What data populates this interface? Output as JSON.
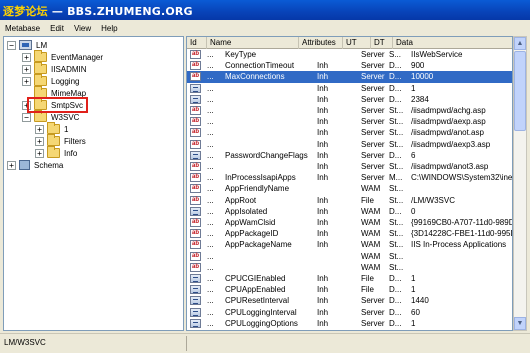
{
  "watermark": {
    "cjk": "逐梦论坛",
    "url": "BBS.ZHUMENG.ORG"
  },
  "menu": {
    "metabase": "Metabase",
    "edit": "Edit",
    "view": "View",
    "help": "Help"
  },
  "tree": {
    "root": {
      "label": "LM",
      "expander": "−"
    },
    "children": [
      {
        "label": "EventManager",
        "expander": "+"
      },
      {
        "label": "IISADMIN",
        "expander": "+"
      },
      {
        "label": "Logging",
        "expander": "+"
      },
      {
        "label": "MimeMap",
        "expander": ""
      },
      {
        "label": "SmtpSvc",
        "expander": "+"
      },
      {
        "label": "W3SVC",
        "expander": "−"
      }
    ],
    "w3svc_children": [
      {
        "label": "1",
        "expander": "+"
      },
      {
        "label": "Filters",
        "expander": "+"
      },
      {
        "label": "Info",
        "expander": "+"
      }
    ],
    "schema": {
      "label": "Schema",
      "expander": "+"
    }
  },
  "columns": [
    "Id",
    "Name",
    "Attributes",
    "UT",
    "DT",
    "Data"
  ],
  "rows": [
    {
      "icon": "ab",
      "id": "...",
      "name": "KeyType",
      "attributes": "",
      "ut": "Server",
      "dt": "S...",
      "data": "IIsWebService"
    },
    {
      "icon": "ab",
      "id": "...",
      "name": "ConnectionTimeout",
      "attributes": "Inh",
      "ut": "Server",
      "dt": "D...",
      "data": "900"
    },
    {
      "icon": "ab",
      "id": "...",
      "name": "MaxConnections",
      "attributes": "Inh",
      "ut": "Server",
      "dt": "D...",
      "data": "10000",
      "selected": true
    },
    {
      "icon": "bin",
      "id": "...",
      "name": "",
      "attributes": "Inh",
      "ut": "Server",
      "dt": "D...",
      "data": "1"
    },
    {
      "icon": "bin",
      "id": "...",
      "name": "",
      "attributes": "Inh",
      "ut": "Server",
      "dt": "D...",
      "data": "2384"
    },
    {
      "icon": "ab",
      "id": "...",
      "name": "",
      "attributes": "Inh",
      "ut": "Server",
      "dt": "St...",
      "data": "/iisadmpwd/achg.asp"
    },
    {
      "icon": "ab",
      "id": "...",
      "name": "",
      "attributes": "Inh",
      "ut": "Server",
      "dt": "St...",
      "data": "/iisadmpwd/aexp.asp"
    },
    {
      "icon": "ab",
      "id": "...",
      "name": "",
      "attributes": "Inh",
      "ut": "Server",
      "dt": "St...",
      "data": "/iisadmpwd/anot.asp"
    },
    {
      "icon": "ab",
      "id": "...",
      "name": "",
      "attributes": "Inh",
      "ut": "Server",
      "dt": "St...",
      "data": "/iisadmpwd/aexp3.asp"
    },
    {
      "icon": "bin",
      "id": "...",
      "name": "PasswordChangeFlags",
      "attributes": "Inh",
      "ut": "Server",
      "dt": "D...",
      "data": "6"
    },
    {
      "icon": "ab",
      "id": "...",
      "name": "",
      "attributes": "Inh",
      "ut": "Server",
      "dt": "St...",
      "data": "/iisadmpwd/anot3.asp"
    },
    {
      "icon": "ab",
      "id": "...",
      "name": "InProcessIsapiApps",
      "attributes": "Inh",
      "ut": "Server",
      "dt": "M...",
      "data": "C:\\WINDOWS\\System32\\inets"
    },
    {
      "icon": "ab",
      "id": "...",
      "name": "AppFriendlyName",
      "attributes": "",
      "ut": "WAM",
      "dt": "St...",
      "data": ""
    },
    {
      "icon": "ab",
      "id": "...",
      "name": "AppRoot",
      "attributes": "Inh",
      "ut": "File",
      "dt": "St...",
      "data": "/LM/W3SVC"
    },
    {
      "icon": "bin",
      "id": "...",
      "name": "AppIsolated",
      "attributes": "Inh",
      "ut": "WAM",
      "dt": "D...",
      "data": "0"
    },
    {
      "icon": "ab",
      "id": "...",
      "name": "AppWamClsid",
      "attributes": "Inh",
      "ut": "WAM",
      "dt": "St...",
      "data": "{99169CB0-A707-11d0-989D-0"
    },
    {
      "icon": "ab",
      "id": "...",
      "name": "AppPackageID",
      "attributes": "Inh",
      "ut": "WAM",
      "dt": "St...",
      "data": "{3D14228C-FBE1-11d0-995D-C"
    },
    {
      "icon": "ab",
      "id": "...",
      "name": "AppPackageName",
      "attributes": "Inh",
      "ut": "WAM",
      "dt": "St...",
      "data": "IIS In-Process Applications"
    },
    {
      "icon": "ab",
      "id": "...",
      "name": "",
      "attributes": "",
      "ut": "WAM",
      "dt": "St...",
      "data": ""
    },
    {
      "icon": "ab",
      "id": "...",
      "name": "",
      "attributes": "",
      "ut": "WAM",
      "dt": "St...",
      "data": ""
    },
    {
      "icon": "bin",
      "id": "...",
      "name": "CPUCGIEnabled",
      "attributes": "Inh",
      "ut": "File",
      "dt": "D...",
      "data": "1"
    },
    {
      "icon": "bin",
      "id": "...",
      "name": "CPUAppEnabled",
      "attributes": "Inh",
      "ut": "File",
      "dt": "D...",
      "data": "1"
    },
    {
      "icon": "bin",
      "id": "...",
      "name": "CPUResetInterval",
      "attributes": "Inh",
      "ut": "Server",
      "dt": "D...",
      "data": "1440"
    },
    {
      "icon": "bin",
      "id": "...",
      "name": "CPULoggingInterval",
      "attributes": "Inh",
      "ut": "Server",
      "dt": "D...",
      "data": "60"
    },
    {
      "icon": "bin",
      "id": "...",
      "name": "CPULoggingOptions",
      "attributes": "Inh",
      "ut": "Server",
      "dt": "D...",
      "data": "1"
    }
  ],
  "status": {
    "path": "LM/W3SVC"
  },
  "colors": {
    "selection": "#316ac5",
    "highlight_box": "#e0201a",
    "titlebar": "#0843b8",
    "watermark_cjk": "#ffd200"
  }
}
